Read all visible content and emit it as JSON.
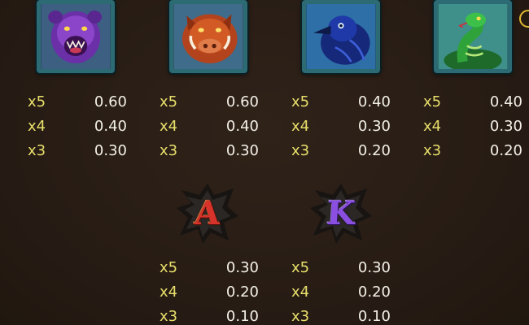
{
  "paytable": {
    "row1": [
      {
        "symbol": "bear-icon",
        "pays": [
          {
            "mult": "x5",
            "value": "0.60"
          },
          {
            "mult": "x4",
            "value": "0.40"
          },
          {
            "mult": "x3",
            "value": "0.30"
          }
        ]
      },
      {
        "symbol": "boar-icon",
        "pays": [
          {
            "mult": "x5",
            "value": "0.60"
          },
          {
            "mult": "x4",
            "value": "0.40"
          },
          {
            "mult": "x3",
            "value": "0.30"
          }
        ]
      },
      {
        "symbol": "raven-icon",
        "pays": [
          {
            "mult": "x5",
            "value": "0.40"
          },
          {
            "mult": "x4",
            "value": "0.30"
          },
          {
            "mult": "x3",
            "value": "0.20"
          }
        ]
      },
      {
        "symbol": "snake-icon",
        "pays": [
          {
            "mult": "x5",
            "value": "0.40"
          },
          {
            "mult": "x4",
            "value": "0.30"
          },
          {
            "mult": "x3",
            "value": "0.20"
          }
        ]
      }
    ],
    "row2": [
      {
        "symbol": "letter-a-icon",
        "letter": "A",
        "pays": [
          {
            "mult": "x5",
            "value": "0.30"
          },
          {
            "mult": "x4",
            "value": "0.20"
          },
          {
            "mult": "x3",
            "value": "0.10"
          }
        ]
      },
      {
        "symbol": "letter-k-icon",
        "letter": "K",
        "pays": [
          {
            "mult": "x5",
            "value": "0.30"
          },
          {
            "mult": "x4",
            "value": "0.20"
          },
          {
            "mult": "x3",
            "value": "0.10"
          }
        ]
      }
    ]
  },
  "colors": {
    "background": "#291e16",
    "multiplier": "#e8df6a",
    "value": "#f3f0e8",
    "frame": "#2c6a74",
    "letter_a": "#d7332a",
    "letter_k": "#8a4ee0"
  }
}
